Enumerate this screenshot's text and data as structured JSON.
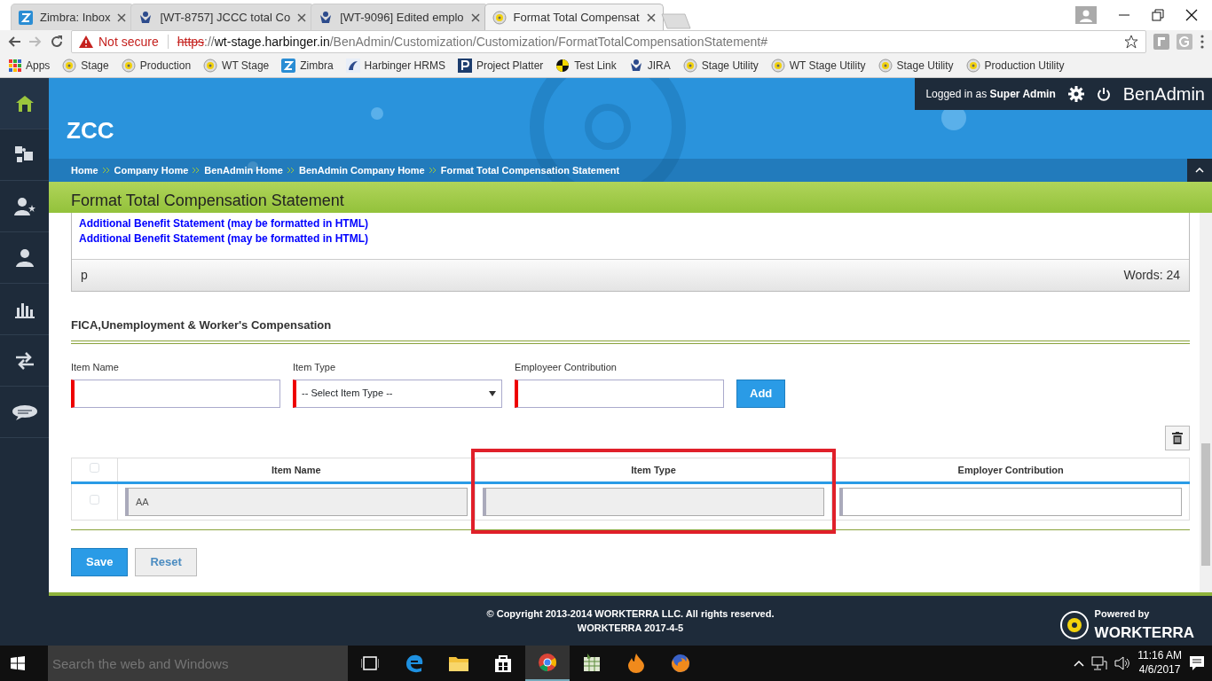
{
  "browser": {
    "tabs": [
      {
        "title": "Zimbra: Inbox",
        "selected": false
      },
      {
        "title": "[WT-8757] JCCC total Co",
        "selected": false
      },
      {
        "title": "[WT-9096] Edited emplo",
        "selected": false
      },
      {
        "title": "Format Total Compensat",
        "selected": true
      }
    ],
    "address": {
      "security": "Not secure",
      "scheme": "https",
      "rest": "://",
      "host": "wt-stage.harbinger.in",
      "path": "/BenAdmin/Customization/Customization/FormatTotalCompensationStatement#"
    },
    "bookmarks": [
      {
        "label": "Apps"
      },
      {
        "label": "Stage"
      },
      {
        "label": "Production"
      },
      {
        "label": "WT Stage"
      },
      {
        "label": "Zimbra"
      },
      {
        "label": "Harbinger HRMS"
      },
      {
        "label": "Project Platter"
      },
      {
        "label": "Test Link"
      },
      {
        "label": "JIRA"
      },
      {
        "label": "Stage Utility"
      },
      {
        "label": "WT Stage Utility"
      },
      {
        "label": "Stage Utility"
      },
      {
        "label": "Production Utility"
      }
    ]
  },
  "sidebar": {
    "items": [
      {
        "selected": true
      },
      {
        "selected": false
      },
      {
        "selected": false
      },
      {
        "selected": false
      },
      {
        "selected": false
      },
      {
        "selected": false
      },
      {
        "selected": false
      }
    ]
  },
  "header": {
    "logo": "ZCC",
    "login_prefix": "Logged in as",
    "user": "Super Admin",
    "brand": "BenAdmin"
  },
  "breadcrumbs": [
    "Home",
    "Company Home",
    "BenAdmin Home",
    "BenAdmin Company Home",
    "Format Total Compensation Statement"
  ],
  "page_title": "Format Total Compensation Statement",
  "editor": {
    "lines": [
      "Additional Benefit Statement (may be formatted in HTML)",
      "Additional Benefit Statement (may be formatted in HTML)"
    ],
    "path": "p",
    "word_count": "Words: 24"
  },
  "section": {
    "title": "FICA,Unemployment & Worker's Compensation",
    "fields": [
      {
        "label": "Item Name",
        "kind": "text"
      },
      {
        "label": "Item Type",
        "kind": "select",
        "value": "-- Select Item Type --"
      },
      {
        "label": "Employeer Contribution",
        "kind": "text"
      }
    ],
    "add_button": "Add"
  },
  "table": {
    "columns": [
      {
        "label": "Item Name",
        "highlighted": false
      },
      {
        "label": "Item Type",
        "highlighted": true
      },
      {
        "label": "Employer Contribution",
        "highlighted": false
      }
    ],
    "header_checked": false,
    "rows": [
      {
        "checked": false,
        "cells": [
          {
            "value": "AA",
            "disabled": true
          },
          {
            "disabled": true
          },
          {
            "disabled": false
          }
        ]
      }
    ]
  },
  "buttons": [
    {
      "label": "Save",
      "kind": "primary"
    },
    {
      "label": "Reset",
      "kind": "secondary"
    }
  ],
  "footer": {
    "copyright": "© Copyright 2013-2014 WORKTERRA LLC. All rights reserved.",
    "version": "WORKTERRA 2017-4-5",
    "powered_by": "Powered by",
    "brand": "WORKTERRA"
  },
  "taskbar": {
    "search_placeholder": "Search the web and Windows",
    "apps": [
      {
        "active": false
      },
      {
        "active": false
      },
      {
        "active": false
      },
      {
        "active": false
      },
      {
        "active": true
      },
      {
        "active": false
      },
      {
        "active": false
      },
      {
        "active": false
      }
    ],
    "time": "11:16 AM",
    "date": "4/6/2017"
  }
}
